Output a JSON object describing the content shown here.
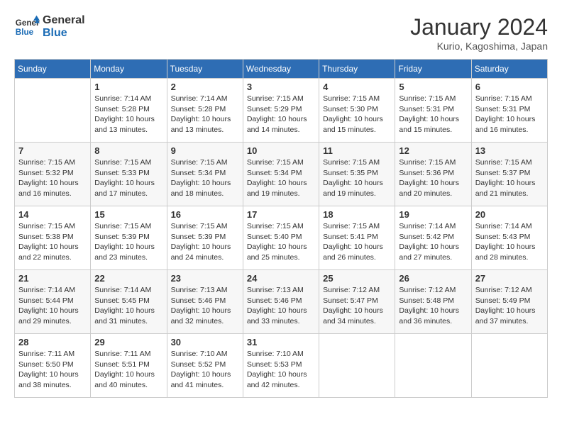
{
  "header": {
    "logo_line1": "General",
    "logo_line2": "Blue",
    "month_title": "January 2024",
    "subtitle": "Kurio, Kagoshima, Japan"
  },
  "days_of_week": [
    "Sunday",
    "Monday",
    "Tuesday",
    "Wednesday",
    "Thursday",
    "Friday",
    "Saturday"
  ],
  "weeks": [
    [
      {
        "day": "",
        "info": ""
      },
      {
        "day": "1",
        "info": "Sunrise: 7:14 AM\nSunset: 5:28 PM\nDaylight: 10 hours\nand 13 minutes."
      },
      {
        "day": "2",
        "info": "Sunrise: 7:14 AM\nSunset: 5:28 PM\nDaylight: 10 hours\nand 13 minutes."
      },
      {
        "day": "3",
        "info": "Sunrise: 7:15 AM\nSunset: 5:29 PM\nDaylight: 10 hours\nand 14 minutes."
      },
      {
        "day": "4",
        "info": "Sunrise: 7:15 AM\nSunset: 5:30 PM\nDaylight: 10 hours\nand 15 minutes."
      },
      {
        "day": "5",
        "info": "Sunrise: 7:15 AM\nSunset: 5:31 PM\nDaylight: 10 hours\nand 15 minutes."
      },
      {
        "day": "6",
        "info": "Sunrise: 7:15 AM\nSunset: 5:31 PM\nDaylight: 10 hours\nand 16 minutes."
      }
    ],
    [
      {
        "day": "7",
        "info": "Sunrise: 7:15 AM\nSunset: 5:32 PM\nDaylight: 10 hours\nand 16 minutes."
      },
      {
        "day": "8",
        "info": "Sunrise: 7:15 AM\nSunset: 5:33 PM\nDaylight: 10 hours\nand 17 minutes."
      },
      {
        "day": "9",
        "info": "Sunrise: 7:15 AM\nSunset: 5:34 PM\nDaylight: 10 hours\nand 18 minutes."
      },
      {
        "day": "10",
        "info": "Sunrise: 7:15 AM\nSunset: 5:34 PM\nDaylight: 10 hours\nand 19 minutes."
      },
      {
        "day": "11",
        "info": "Sunrise: 7:15 AM\nSunset: 5:35 PM\nDaylight: 10 hours\nand 19 minutes."
      },
      {
        "day": "12",
        "info": "Sunrise: 7:15 AM\nSunset: 5:36 PM\nDaylight: 10 hours\nand 20 minutes."
      },
      {
        "day": "13",
        "info": "Sunrise: 7:15 AM\nSunset: 5:37 PM\nDaylight: 10 hours\nand 21 minutes."
      }
    ],
    [
      {
        "day": "14",
        "info": "Sunrise: 7:15 AM\nSunset: 5:38 PM\nDaylight: 10 hours\nand 22 minutes."
      },
      {
        "day": "15",
        "info": "Sunrise: 7:15 AM\nSunset: 5:39 PM\nDaylight: 10 hours\nand 23 minutes."
      },
      {
        "day": "16",
        "info": "Sunrise: 7:15 AM\nSunset: 5:39 PM\nDaylight: 10 hours\nand 24 minutes."
      },
      {
        "day": "17",
        "info": "Sunrise: 7:15 AM\nSunset: 5:40 PM\nDaylight: 10 hours\nand 25 minutes."
      },
      {
        "day": "18",
        "info": "Sunrise: 7:15 AM\nSunset: 5:41 PM\nDaylight: 10 hours\nand 26 minutes."
      },
      {
        "day": "19",
        "info": "Sunrise: 7:14 AM\nSunset: 5:42 PM\nDaylight: 10 hours\nand 27 minutes."
      },
      {
        "day": "20",
        "info": "Sunrise: 7:14 AM\nSunset: 5:43 PM\nDaylight: 10 hours\nand 28 minutes."
      }
    ],
    [
      {
        "day": "21",
        "info": "Sunrise: 7:14 AM\nSunset: 5:44 PM\nDaylight: 10 hours\nand 29 minutes."
      },
      {
        "day": "22",
        "info": "Sunrise: 7:14 AM\nSunset: 5:45 PM\nDaylight: 10 hours\nand 31 minutes."
      },
      {
        "day": "23",
        "info": "Sunrise: 7:13 AM\nSunset: 5:46 PM\nDaylight: 10 hours\nand 32 minutes."
      },
      {
        "day": "24",
        "info": "Sunrise: 7:13 AM\nSunset: 5:46 PM\nDaylight: 10 hours\nand 33 minutes."
      },
      {
        "day": "25",
        "info": "Sunrise: 7:12 AM\nSunset: 5:47 PM\nDaylight: 10 hours\nand 34 minutes."
      },
      {
        "day": "26",
        "info": "Sunrise: 7:12 AM\nSunset: 5:48 PM\nDaylight: 10 hours\nand 36 minutes."
      },
      {
        "day": "27",
        "info": "Sunrise: 7:12 AM\nSunset: 5:49 PM\nDaylight: 10 hours\nand 37 minutes."
      }
    ],
    [
      {
        "day": "28",
        "info": "Sunrise: 7:11 AM\nSunset: 5:50 PM\nDaylight: 10 hours\nand 38 minutes."
      },
      {
        "day": "29",
        "info": "Sunrise: 7:11 AM\nSunset: 5:51 PM\nDaylight: 10 hours\nand 40 minutes."
      },
      {
        "day": "30",
        "info": "Sunrise: 7:10 AM\nSunset: 5:52 PM\nDaylight: 10 hours\nand 41 minutes."
      },
      {
        "day": "31",
        "info": "Sunrise: 7:10 AM\nSunset: 5:53 PM\nDaylight: 10 hours\nand 42 minutes."
      },
      {
        "day": "",
        "info": ""
      },
      {
        "day": "",
        "info": ""
      },
      {
        "day": "",
        "info": ""
      }
    ]
  ]
}
